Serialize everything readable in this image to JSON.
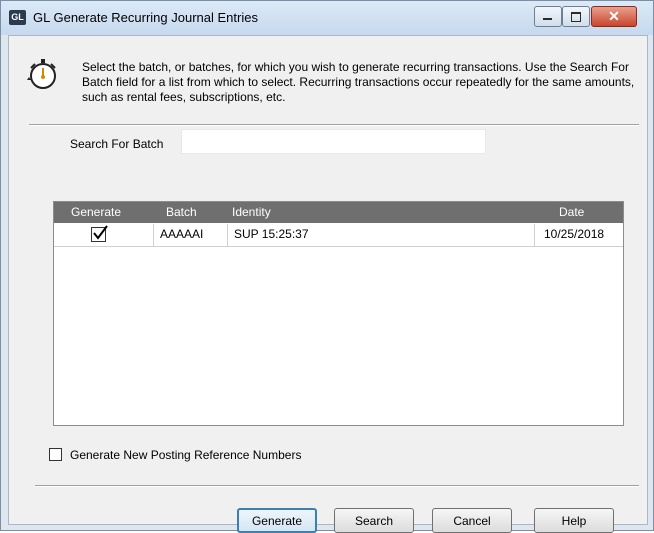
{
  "window": {
    "app_badge": "GL",
    "title": "GL Generate Recurring Journal Entries",
    "controls": {
      "minimize": "–",
      "maximize": "□",
      "close": "✕"
    }
  },
  "instructions": "Select the batch, or batches, for which you wish to generate recurring transactions.  Use the Search For Batch field for a list from which to select.  Recurring transactions occur repeatedly for the same amounts, such as rental fees, subscriptions, etc.",
  "search": {
    "label": "Search For Batch",
    "value": ""
  },
  "grid": {
    "columns": {
      "generate": "Generate",
      "batch": "Batch",
      "identity": "Identity",
      "date": "Date"
    },
    "rows": [
      {
        "generate": true,
        "batch": "AAAAAI",
        "identity": "SUP 15:25:37",
        "date": "10/25/2018"
      }
    ]
  },
  "options": {
    "new_posting_ref": {
      "label": "Generate New Posting Reference Numbers",
      "checked": false
    }
  },
  "buttons": {
    "generate": "Generate",
    "search": "Search",
    "cancel": "Cancel",
    "help": "Help"
  }
}
